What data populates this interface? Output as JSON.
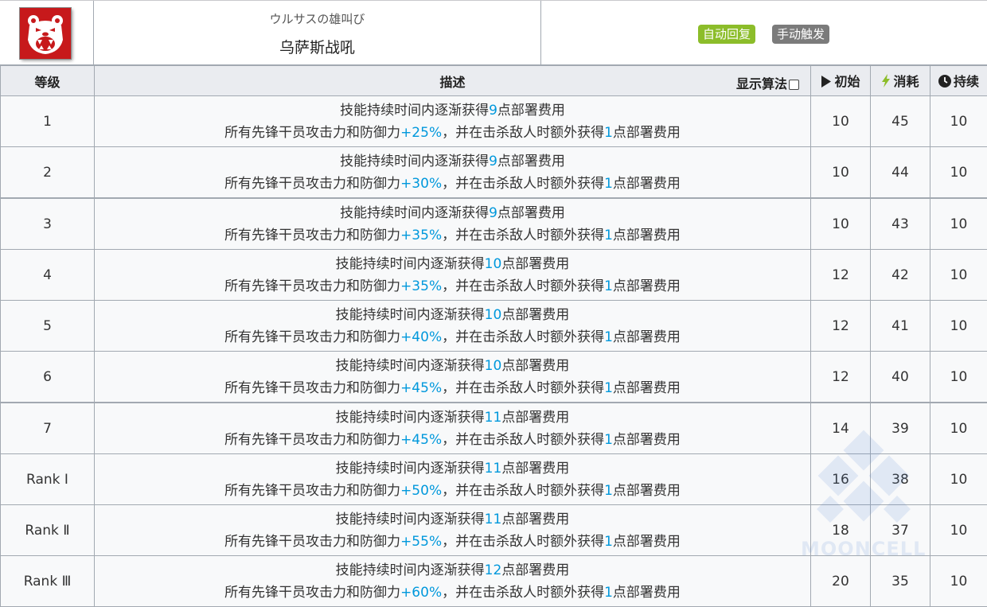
{
  "skill": {
    "jp_name": "ウルサスの雄叫び",
    "cn_name": "乌萨斯战吼",
    "icon": "roaring-bear-icon",
    "tags": {
      "recovery": "自动回复",
      "trigger": "手动触发"
    }
  },
  "table": {
    "headers": {
      "level": "等级",
      "description": "描述",
      "show_formula": "显示算法",
      "initial": "初始",
      "cost": "消耗",
      "duration": "持续"
    },
    "rows": [
      {
        "level": "1",
        "l1a": "技能持续时间内逐渐获得",
        "dp": "9",
        "l1b": "点部署费用",
        "l2a": "所有先锋干员攻击力和防御力",
        "buff": "+25%",
        "l2b": "，并在击杀敌人时额外获得",
        "bonus": "1",
        "l2c": "点部署费用",
        "initial": "10",
        "cost": "45",
        "duration": "10"
      },
      {
        "level": "2",
        "l1a": "技能持续时间内逐渐获得",
        "dp": "9",
        "l1b": "点部署费用",
        "l2a": "所有先锋干员攻击力和防御力",
        "buff": "+30%",
        "l2b": "，并在击杀敌人时额外获得",
        "bonus": "1",
        "l2c": "点部署费用",
        "initial": "10",
        "cost": "44",
        "duration": "10"
      },
      {
        "level": "3",
        "l1a": "技能持续时间内逐渐获得",
        "dp": "9",
        "l1b": "点部署费用",
        "l2a": "所有先锋干员攻击力和防御力",
        "buff": "+35%",
        "l2b": "，并在击杀敌人时额外获得",
        "bonus": "1",
        "l2c": "点部署费用",
        "initial": "10",
        "cost": "43",
        "duration": "10"
      },
      {
        "level": "4",
        "l1a": "技能持续时间内逐渐获得",
        "dp": "10",
        "l1b": "点部署费用",
        "l2a": "所有先锋干员攻击力和防御力",
        "buff": "+35%",
        "l2b": "，并在击杀敌人时额外获得",
        "bonus": "1",
        "l2c": "点部署费用",
        "initial": "12",
        "cost": "42",
        "duration": "10"
      },
      {
        "level": "5",
        "l1a": "技能持续时间内逐渐获得",
        "dp": "10",
        "l1b": "点部署费用",
        "l2a": "所有先锋干员攻击力和防御力",
        "buff": "+40%",
        "l2b": "，并在击杀敌人时额外获得",
        "bonus": "1",
        "l2c": "点部署费用",
        "initial": "12",
        "cost": "41",
        "duration": "10"
      },
      {
        "level": "6",
        "l1a": "技能持续时间内逐渐获得",
        "dp": "10",
        "l1b": "点部署费用",
        "l2a": "所有先锋干员攻击力和防御力",
        "buff": "+45%",
        "l2b": "，并在击杀敌人时额外获得",
        "bonus": "1",
        "l2c": "点部署费用",
        "initial": "12",
        "cost": "40",
        "duration": "10"
      },
      {
        "level": "7",
        "l1a": "技能持续时间内逐渐获得",
        "dp": "11",
        "l1b": "点部署费用",
        "l2a": "所有先锋干员攻击力和防御力",
        "buff": "+45%",
        "l2b": "，并在击杀敌人时额外获得",
        "bonus": "1",
        "l2c": "点部署费用",
        "initial": "14",
        "cost": "39",
        "duration": "10"
      },
      {
        "level": "Rank Ⅰ",
        "l1a": "技能持续时间内逐渐获得",
        "dp": "11",
        "l1b": "点部署费用",
        "l2a": "所有先锋干员攻击力和防御力",
        "buff": "+50%",
        "l2b": "，并在击杀敌人时额外获得",
        "bonus": "1",
        "l2c": "点部署费用",
        "initial": "16",
        "cost": "38",
        "duration": "10"
      },
      {
        "level": "Rank Ⅱ",
        "l1a": "技能持续时间内逐渐获得",
        "dp": "11",
        "l1b": "点部署费用",
        "l2a": "所有先锋干员攻击力和防御力",
        "buff": "+55%",
        "l2b": "，并在击杀敌人时额外获得",
        "bonus": "1",
        "l2c": "点部署费用",
        "initial": "18",
        "cost": "37",
        "duration": "10"
      },
      {
        "level": "Rank Ⅲ",
        "l1a": "技能持续时间内逐渐获得",
        "dp": "12",
        "l1b": "点部署费用",
        "l2a": "所有先锋干员攻击力和防御力",
        "buff": "+60%",
        "l2b": "，并在击杀敌人时额外获得",
        "bonus": "1",
        "l2c": "点部署费用",
        "initial": "20",
        "cost": "35",
        "duration": "10"
      }
    ]
  },
  "watermark": {
    "text": "MOONCELL",
    "icon": "mooncell-logo-icon"
  },
  "colors": {
    "highlight": "#0098dc",
    "tag_auto": "#8cbd2a",
    "tag_manual": "#7b7b7b",
    "icon_bg": "#c7191b"
  }
}
